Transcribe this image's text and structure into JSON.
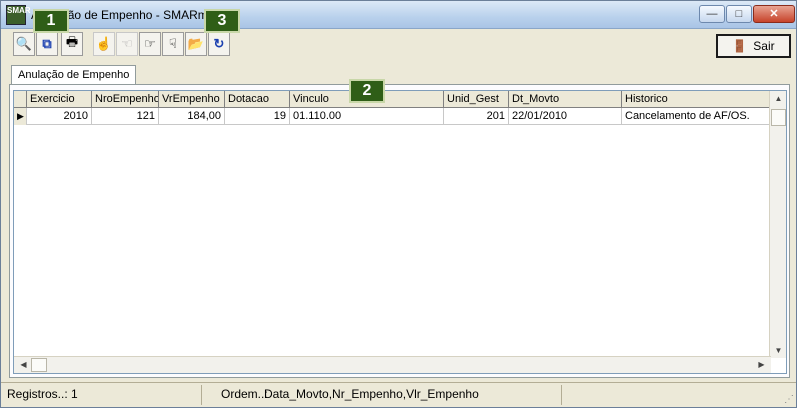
{
  "window": {
    "title": "Anulação de Empenho - SMARm",
    "minimize_glyph": "—",
    "maximize_glyph": "□",
    "close_glyph": "✕",
    "app_icon_text": "SMAR"
  },
  "toolbar": {
    "buttons": [
      {
        "icon": "binoculars-search-icon",
        "glyph": "🔍"
      },
      {
        "icon": "copy-icon",
        "glyph": "⧉"
      },
      {
        "icon": "print-icon",
        "glyph": "🖶"
      },
      {
        "icon": "hand-up-icon",
        "glyph": "☝"
      },
      {
        "icon": "hand-left-icon",
        "glyph": "☜"
      },
      {
        "icon": "hand-right-icon",
        "glyph": "☞"
      },
      {
        "icon": "hand-down-icon",
        "glyph": "☟"
      },
      {
        "icon": "folder-edit-icon",
        "glyph": "📂"
      },
      {
        "icon": "refresh-icon",
        "glyph": "↻"
      }
    ],
    "exit_label": "Sair",
    "exit_icon_glyph": "🚪"
  },
  "callouts": [
    "1",
    "2",
    "3"
  ],
  "tabs": [
    {
      "label": "Anulação de Empenho"
    }
  ],
  "grid": {
    "columns": [
      "Exercicio",
      "NroEmpenho",
      "VrEmpenho",
      "Dotacao",
      "Vinculo",
      "Unid_Gest",
      "Dt_Movto",
      "Historico"
    ],
    "rows": [
      {
        "indicator": "▶",
        "Exercicio": "2010",
        "NroEmpenho": "121",
        "VrEmpenho": "184,00",
        "Dotacao": "19",
        "Vinculo": "01.110.00",
        "Unid_Gest": "201",
        "Dt_Movto": "22/01/2010",
        "Historico": "Cancelamento de AF/OS."
      }
    ]
  },
  "status": {
    "registros": "Registros..: 1",
    "ordem_label": "Ordem..:",
    "ordem_value": "Data_Movto,Nr_Empenho,Vlr_Empenho"
  },
  "colors": {
    "callout_bg": "#2f5e17",
    "window_bg": "#ece9d8"
  }
}
